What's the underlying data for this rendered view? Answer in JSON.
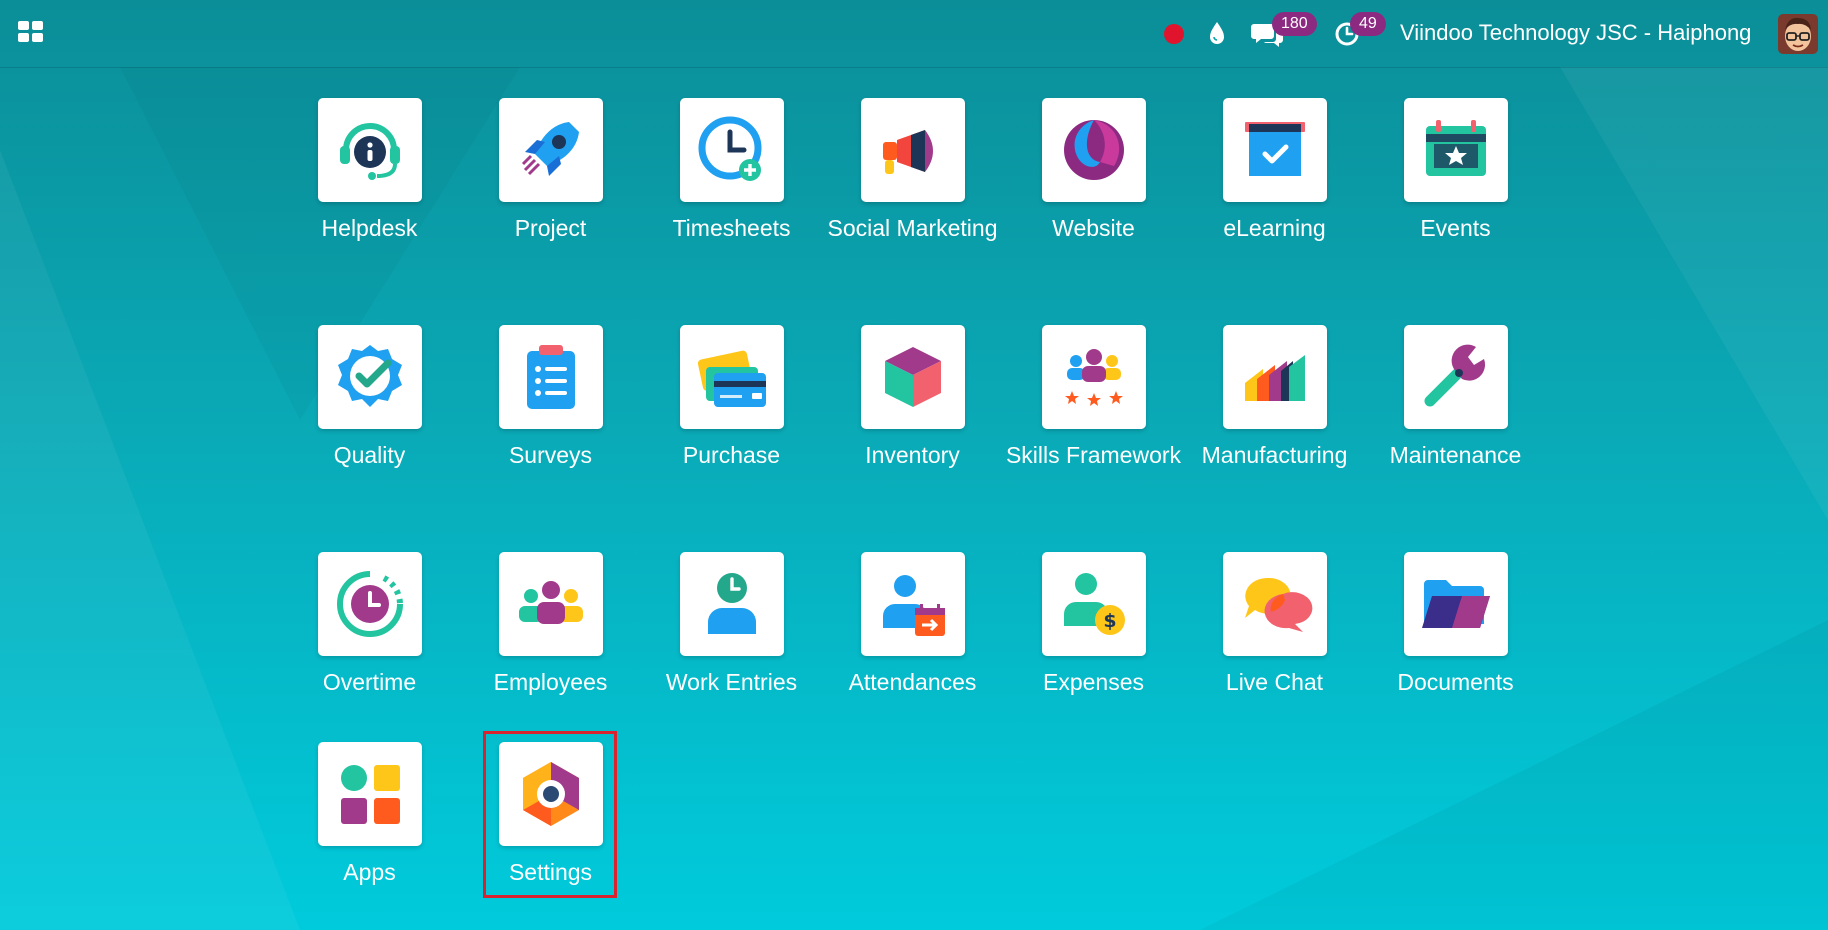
{
  "header": {
    "company": "Viindoo Technology JSC - Haiphong",
    "messages_count": "180",
    "activities_count": "49"
  },
  "apps": [
    {
      "label": "Helpdesk",
      "icon": "helpdesk-icon"
    },
    {
      "label": "Project",
      "icon": "rocket-icon"
    },
    {
      "label": "Timesheets",
      "icon": "clock-plus-icon"
    },
    {
      "label": "Social Marketing",
      "icon": "megaphone-icon"
    },
    {
      "label": "Website",
      "icon": "website-icon"
    },
    {
      "label": "eLearning",
      "icon": "elearning-icon"
    },
    {
      "label": "Events",
      "icon": "calendar-star-icon"
    },
    {
      "label": "Quality",
      "icon": "quality-badge-icon"
    },
    {
      "label": "Surveys",
      "icon": "clipboard-list-icon"
    },
    {
      "label": "Purchase",
      "icon": "credit-cards-icon"
    },
    {
      "label": "Inventory",
      "icon": "cube-icon"
    },
    {
      "label": "Skills Framework",
      "icon": "people-stars-icon"
    },
    {
      "label": "Manufacturing",
      "icon": "factory-icon"
    },
    {
      "label": "Maintenance",
      "icon": "wrench-icon"
    },
    {
      "label": "Overtime",
      "icon": "overtime-clock-icon"
    },
    {
      "label": "Employees",
      "icon": "employees-icon"
    },
    {
      "label": "Work Entries",
      "icon": "person-clock-icon"
    },
    {
      "label": "Attendances",
      "icon": "person-calendar-icon"
    },
    {
      "label": "Expenses",
      "icon": "person-dollar-icon"
    },
    {
      "label": "Live Chat",
      "icon": "chat-bubbles-icon"
    },
    {
      "label": "Documents",
      "icon": "folder-icon"
    },
    {
      "label": "Apps",
      "icon": "apps-grid-icon"
    },
    {
      "label": "Settings",
      "icon": "settings-hexagon-icon"
    }
  ],
  "colors": {
    "accent_purple": "#8c2a82",
    "highlight_red": "#d9232e",
    "background_top": "#0b8e98",
    "background_bottom": "#00cbdc"
  }
}
